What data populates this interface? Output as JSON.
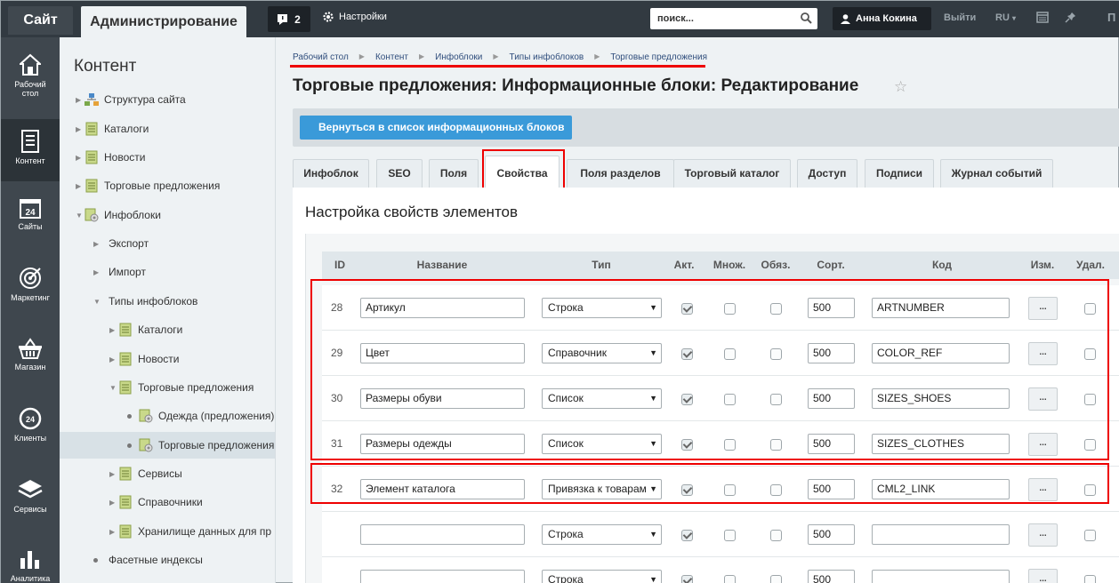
{
  "topbar": {
    "site_tab": "Сайт",
    "admin_tab": "Администрирование",
    "notifications_count": "2",
    "settings_label": "Настройки",
    "search_placeholder": "поиск...",
    "user_name": "Анна Кокина",
    "logout_label": "Выйти",
    "lang_label": "RU",
    "p_label": "П"
  },
  "leftnav": {
    "items": [
      {
        "label": "Рабочий стол",
        "icon": "home-icon"
      },
      {
        "label": "Контент",
        "icon": "document-icon"
      },
      {
        "label": "Сайты",
        "icon": "calendar-icon",
        "icon_text": "24"
      },
      {
        "label": "Маркетинг",
        "icon": "target-icon"
      },
      {
        "label": "Магазин",
        "icon": "basket-icon"
      },
      {
        "label": "Клиенты",
        "icon": "clients-24-icon",
        "icon_text": "24"
      },
      {
        "label": "Сервисы",
        "icon": "layers-icon"
      },
      {
        "label": "Аналитика",
        "icon": "chart-icon"
      }
    ]
  },
  "sidebar": {
    "title": "Контент",
    "items": [
      {
        "label": "Структура сайта"
      },
      {
        "label": "Каталоги"
      },
      {
        "label": "Новости"
      },
      {
        "label": "Торговые предложения"
      },
      {
        "label": "Инфоблоки"
      },
      {
        "label": "Экспорт"
      },
      {
        "label": "Импорт"
      },
      {
        "label": "Типы инфоблоков"
      },
      {
        "label": "Каталоги"
      },
      {
        "label": "Новости"
      },
      {
        "label": "Торговые предложения"
      },
      {
        "label": "Одежда (предложения)"
      },
      {
        "label": "Торговые предложения"
      },
      {
        "label": "Сервисы"
      },
      {
        "label": "Справочники"
      },
      {
        "label": "Хранилище данных для пр"
      },
      {
        "label": "Фасетные индексы"
      }
    ]
  },
  "breadcrumb": [
    "Рабочий стол",
    "Контент",
    "Инфоблоки",
    "Типы инфоблоков",
    "Торговые предложения"
  ],
  "page_title": "Торговые предложения: Информационные блоки: Редактирование",
  "back_button": "Вернуться в список информационных блоков",
  "tabs": [
    "Инфоблок",
    "SEO",
    "Поля",
    "Свойства",
    "Поля разделов",
    "Торговый каталог",
    "Доступ",
    "Подписи",
    "Журнал событий"
  ],
  "active_tab": "Свойства",
  "section_title": "Настройка свойств элементов",
  "table": {
    "headers": [
      "ID",
      "Название",
      "Тип",
      "Акт.",
      "Множ.",
      "Обяз.",
      "Сорт.",
      "Код",
      "Изм.",
      "Удал."
    ],
    "rows": [
      {
        "id": "28",
        "name": "Артикул",
        "type": "Строка",
        "active": true,
        "sort": "500",
        "code": "ARTNUMBER"
      },
      {
        "id": "29",
        "name": "Цвет",
        "type": "Справочник",
        "active": true,
        "sort": "500",
        "code": "COLOR_REF"
      },
      {
        "id": "30",
        "name": "Размеры обуви",
        "type": "Список",
        "active": true,
        "sort": "500",
        "code": "SIZES_SHOES"
      },
      {
        "id": "31",
        "name": "Размеры одежды",
        "type": "Список",
        "active": true,
        "sort": "500",
        "code": "SIZES_CLOTHES"
      },
      {
        "id": "32",
        "name": "Элемент каталога",
        "type": "Привязка к товарам",
        "active": true,
        "sort": "500",
        "code": "CML2_LINK"
      },
      {
        "id": "",
        "name": "",
        "type": "Строка",
        "active": true,
        "sort": "500",
        "code": ""
      },
      {
        "id": "",
        "name": "",
        "type": "Строка",
        "active": true,
        "sort": "500",
        "code": ""
      }
    ],
    "edit_button": "..."
  }
}
